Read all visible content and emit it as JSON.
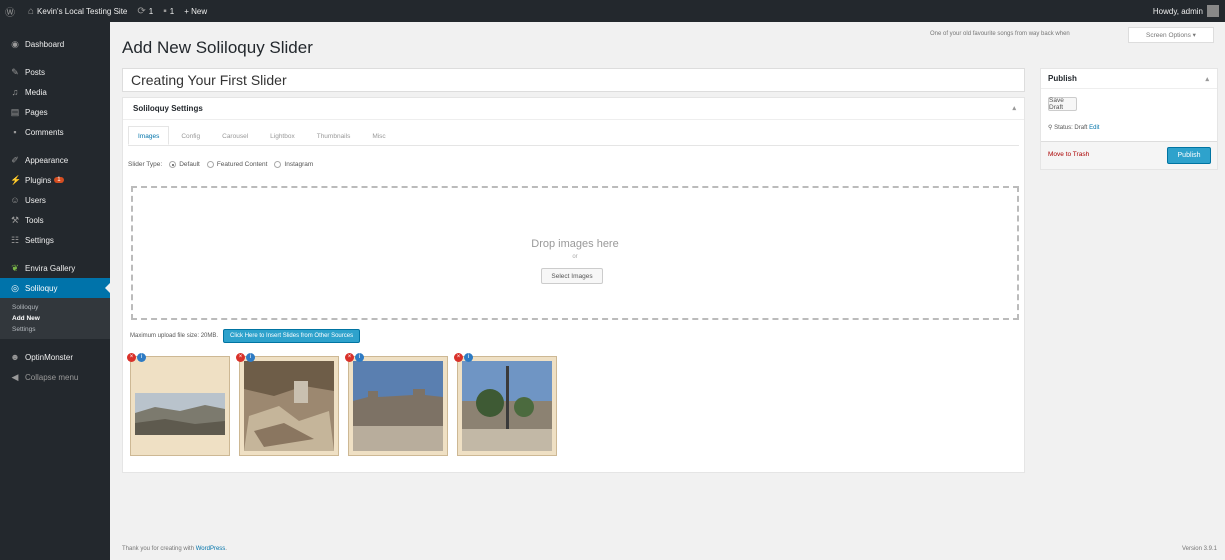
{
  "adminbar": {
    "site_name": "Kevin's Local Testing Site",
    "updates_count": "1",
    "comments_count": "1",
    "new_label": "+ New",
    "howdy": "Howdy, admin"
  },
  "sidebar": {
    "items": [
      {
        "label": "Dashboard",
        "icon": "dashboard-icon"
      },
      {
        "label": "Posts",
        "icon": "pin-icon"
      },
      {
        "label": "Media",
        "icon": "media-icon"
      },
      {
        "label": "Pages",
        "icon": "pages-icon"
      },
      {
        "label": "Comments",
        "icon": "comment-icon"
      },
      {
        "label": "Appearance",
        "icon": "brush-icon"
      },
      {
        "label": "Plugins",
        "icon": "plugin-icon",
        "badge": "1"
      },
      {
        "label": "Users",
        "icon": "users-icon"
      },
      {
        "label": "Tools",
        "icon": "wrench-icon"
      },
      {
        "label": "Settings",
        "icon": "settings-icon"
      },
      {
        "label": "Envira Gallery",
        "icon": "leaf-icon"
      },
      {
        "label": "Soliloquy",
        "icon": "soliloquy-icon"
      },
      {
        "label": "OptinMonster",
        "icon": "monster-icon"
      },
      {
        "label": "Collapse menu",
        "icon": "collapse-icon"
      }
    ],
    "submenu": [
      "Soliloquy",
      "Add New",
      "Settings"
    ]
  },
  "page": {
    "title": "Add New Soliloquy Slider",
    "screen_note": "One of your old favourite songs from way back when",
    "screen_options": "Screen Options"
  },
  "editor": {
    "post_title": "Creating Your First Slider",
    "settings_title": "Soliloquy Settings",
    "tabs": [
      "Images",
      "Config",
      "Carousel",
      "Lightbox",
      "Thumbnails",
      "Misc"
    ],
    "slider_type_label": "Slider Type:",
    "slider_types": [
      "Default",
      "Featured Content",
      "Instagram"
    ],
    "drop_text": "Drop images here",
    "or_text": "or",
    "select_images": "Select Images",
    "max_upload": "Maximum upload file size: 20MB.",
    "insert_button": "Click Here to Insert Slides from Other Sources"
  },
  "publish": {
    "title": "Publish",
    "save_draft": "Save Draft",
    "status_label": "Status: Draft",
    "status_edit": "Edit",
    "trash": "Move to Trash",
    "publish_button": "Publish"
  },
  "footer": {
    "thanks_prefix": "Thank you for creating with",
    "wordpress": "WordPress",
    "version": "Version 3.9.1"
  },
  "colors": {
    "adminbar_bg": "#23282d",
    "accent": "#0073aa",
    "button_blue": "#2ea2cc",
    "trash_red": "#aa0000"
  }
}
